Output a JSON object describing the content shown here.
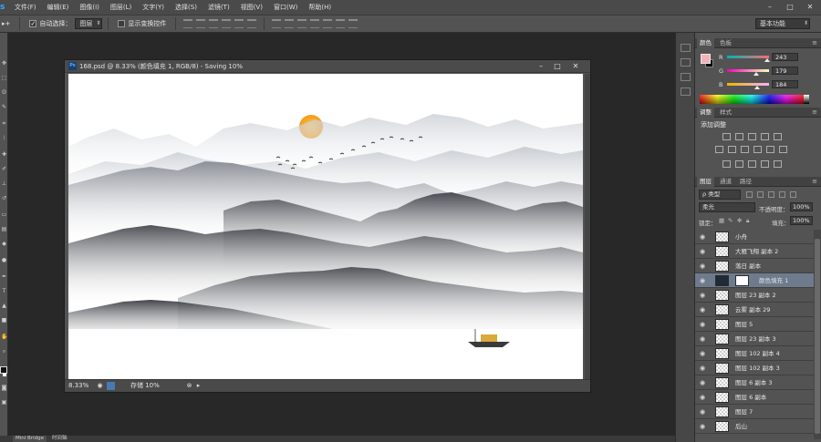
{
  "menubar": {
    "logo": "s",
    "items": [
      "文件(F)",
      "编辑(E)",
      "图像(I)",
      "图层(L)",
      "文字(Y)",
      "选择(S)",
      "滤镜(T)",
      "视图(V)",
      "窗口(W)",
      "帮助(H)"
    ],
    "controls": [
      "–",
      "□",
      "✕"
    ]
  },
  "options": {
    "tool_icon": "▸+",
    "auto_select_label": "自动选择：",
    "auto_select_value": "图层",
    "show_transform_label": "显示变换控件",
    "workspace": "基本功能"
  },
  "document": {
    "ps_icon": "Ps",
    "title": "168.psd @ 8.33% (颜色填充 1, RGB/8) - Saving 10%",
    "zoom": "8.33%",
    "status": "存储 10%",
    "controls": [
      "–",
      "□",
      "✕"
    ]
  },
  "color_panel": {
    "tabs": [
      "颜色",
      "色板"
    ],
    "fg_color": "#f3b3b8",
    "bg_color": "#000000",
    "channels": [
      {
        "label": "R",
        "value": "243",
        "level": 0.95
      },
      {
        "label": "G",
        "value": "179",
        "level": 0.7
      },
      {
        "label": "B",
        "value": "184",
        "level": 0.72
      }
    ]
  },
  "adjustments_panel": {
    "tabs": [
      "调整",
      "样式"
    ],
    "title": "添加调整"
  },
  "layers_panel": {
    "tabs": [
      "图层",
      "通道",
      "路径"
    ],
    "filter_kind": "ρ 类型",
    "blend_mode": "柔光",
    "opacity_label": "不透明度：",
    "opacity_value": "100%",
    "lock_label": "锁定：",
    "fill_label": "填充：",
    "fill_value": "100%",
    "layers": [
      {
        "name": "小舟",
        "selected": false
      },
      {
        "name": "大雁飞翔 副本 2",
        "selected": false
      },
      {
        "name": "落日 副本",
        "selected": false
      },
      {
        "name": "颜色填充 1",
        "selected": true
      },
      {
        "name": "图层 23 副本 2",
        "selected": false
      },
      {
        "name": "云雾 副本 29",
        "selected": false
      },
      {
        "name": "图层 5",
        "selected": false
      },
      {
        "name": "图层 23 副本 3",
        "selected": false
      },
      {
        "name": "图层 102 副本 4",
        "selected": false
      },
      {
        "name": "图层 102 副本 3",
        "selected": false
      },
      {
        "name": "图层 6 副本 3",
        "selected": false
      },
      {
        "name": "图层 6 副本",
        "selected": false
      },
      {
        "name": "图层 7",
        "selected": false
      },
      {
        "name": "后山",
        "selected": false
      }
    ]
  },
  "bottom_tabs": [
    "Mini Bridge",
    "时间轴"
  ]
}
